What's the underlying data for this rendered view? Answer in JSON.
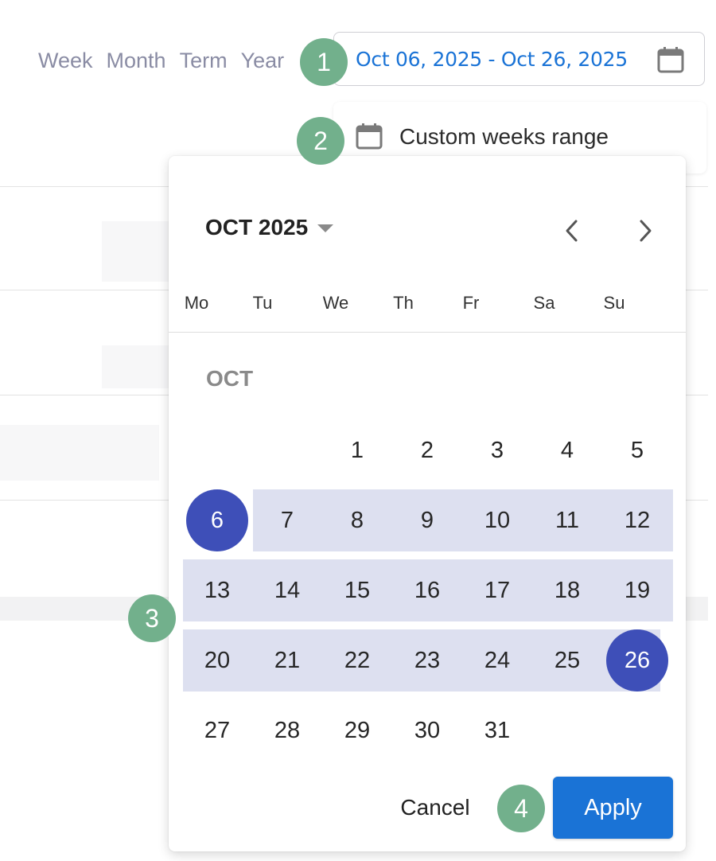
{
  "period_tabs": [
    "Week",
    "Month",
    "Term",
    "Year"
  ],
  "date_range": {
    "value": "Oct 06, 2025 - Oct 26, 2025",
    "icon": "calendar-icon"
  },
  "custom_range_option": {
    "label": "Custom weeks range",
    "icon": "calendar-icon"
  },
  "calendar": {
    "month_year": "OCT 2025",
    "weekdays": [
      "Mo",
      "Tu",
      "We",
      "Th",
      "Fr",
      "Sa",
      "Su"
    ],
    "section_label": "OCT",
    "weeks": [
      [
        "",
        "",
        "1",
        "2",
        "3",
        "4",
        "5"
      ],
      [
        "6",
        "7",
        "8",
        "9",
        "10",
        "11",
        "12"
      ],
      [
        "13",
        "14",
        "15",
        "16",
        "17",
        "18",
        "19"
      ],
      [
        "20",
        "21",
        "22",
        "23",
        "24",
        "25",
        "26"
      ],
      [
        "27",
        "28",
        "29",
        "30",
        "31",
        "",
        ""
      ]
    ],
    "range_start": "6",
    "range_end": "26",
    "range_color": "#dde0f0",
    "endpoint_color": "#3e4fb8",
    "cancel_label": "Cancel",
    "apply_label": "Apply"
  },
  "step_markers": [
    "1",
    "2",
    "3",
    "4"
  ],
  "colors": {
    "accent": "#1a73d6",
    "marker": "#72b08c"
  }
}
